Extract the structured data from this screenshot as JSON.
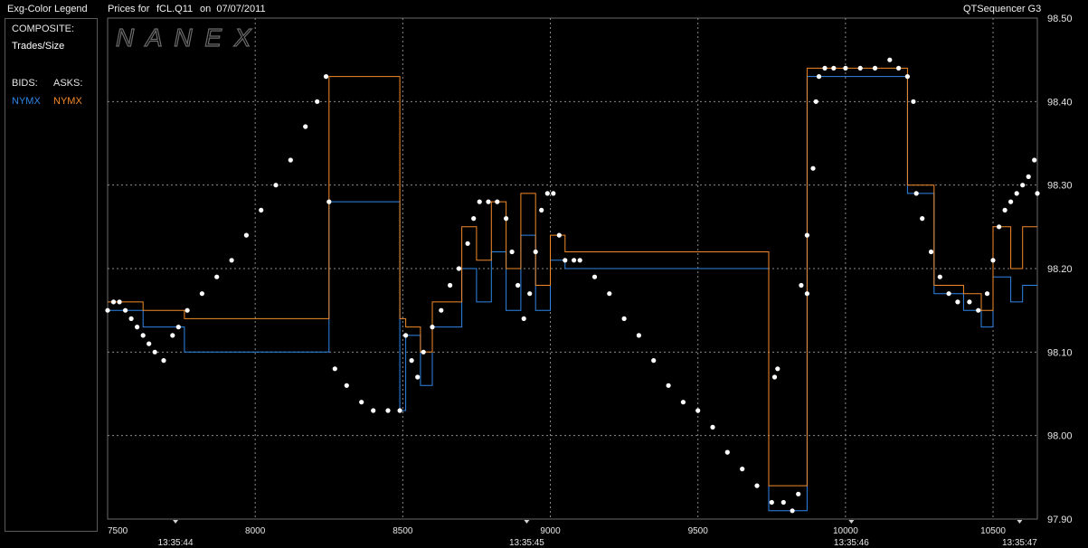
{
  "header": {
    "legend_title": "Exg-Color Legend",
    "title_label": "Prices for",
    "symbol": "fCL.Q11",
    "date_label": "on  07/07/2011",
    "app_name": "QTSequencer G3"
  },
  "legend": {
    "composite_label": "COMPOSITE:",
    "trades_label": "Trades/Size",
    "bids_label": "BIDS:",
    "asks_label": "ASKS:",
    "bid_exchange": "NYMX",
    "ask_exchange": "NYMX",
    "bid_color": "#2f86e6",
    "ask_color": "#f28a2a"
  },
  "watermark": "N A N E X",
  "colors": {
    "background": "#000000",
    "grid": "#8a8a8a",
    "trades": "#ffffff",
    "bid": "#2f86e6",
    "ask": "#f28a2a"
  },
  "chart_data": {
    "type": "scatter",
    "x_axis": {
      "range": [
        7500,
        10650
      ],
      "ticks": [
        7500,
        8000,
        8500,
        9000,
        9500,
        10000,
        10500
      ],
      "tick_labels": [
        "7500",
        "8000",
        "8500",
        "9000",
        "9500",
        "10000",
        "10500"
      ],
      "time_markers": [
        {
          "x": 7730,
          "label": "13:35:44"
        },
        {
          "x": 8920,
          "label": "13:35:45"
        },
        {
          "x": 10020,
          "label": "13:35:46"
        },
        {
          "x": 10590,
          "label": "13:35:47"
        }
      ]
    },
    "y_axis": {
      "range": [
        97.9,
        98.5
      ],
      "ticks": [
        97.9,
        98.0,
        98.1,
        98.2,
        98.3,
        98.4,
        98.5
      ],
      "tick_labels": [
        "97.90",
        "98.00",
        "98.10",
        "98.20",
        "98.30",
        "98.40",
        "98.50"
      ],
      "position": "right"
    },
    "grid": true,
    "series": [
      {
        "name": "Trades/Size",
        "style": "dots",
        "points": [
          [
            7500,
            98.15
          ],
          [
            7520,
            98.16
          ],
          [
            7540,
            98.16
          ],
          [
            7560,
            98.15
          ],
          [
            7580,
            98.14
          ],
          [
            7600,
            98.13
          ],
          [
            7620,
            98.12
          ],
          [
            7640,
            98.11
          ],
          [
            7660,
            98.1
          ],
          [
            7690,
            98.09
          ],
          [
            7720,
            98.12
          ],
          [
            7740,
            98.13
          ],
          [
            7770,
            98.15
          ],
          [
            7820,
            98.17
          ],
          [
            7870,
            98.19
          ],
          [
            7920,
            98.21
          ],
          [
            7970,
            98.24
          ],
          [
            8020,
            98.27
          ],
          [
            8070,
            98.3
          ],
          [
            8120,
            98.33
          ],
          [
            8170,
            98.37
          ],
          [
            8210,
            98.4
          ],
          [
            8240,
            98.43
          ],
          [
            8250,
            98.28
          ],
          [
            8270,
            98.08
          ],
          [
            8310,
            98.06
          ],
          [
            8360,
            98.04
          ],
          [
            8400,
            98.03
          ],
          [
            8450,
            98.03
          ],
          [
            8490,
            98.03
          ],
          [
            8510,
            98.12
          ],
          [
            8530,
            98.09
          ],
          [
            8550,
            98.07
          ],
          [
            8570,
            98.1
          ],
          [
            8600,
            98.13
          ],
          [
            8630,
            98.15
          ],
          [
            8660,
            98.18
          ],
          [
            8690,
            98.2
          ],
          [
            8720,
            98.23
          ],
          [
            8740,
            98.26
          ],
          [
            8760,
            98.28
          ],
          [
            8790,
            98.28
          ],
          [
            8820,
            98.28
          ],
          [
            8850,
            98.26
          ],
          [
            8870,
            98.22
          ],
          [
            8890,
            98.18
          ],
          [
            8910,
            98.14
          ],
          [
            8930,
            98.17
          ],
          [
            8950,
            98.22
          ],
          [
            8970,
            98.27
          ],
          [
            8990,
            98.29
          ],
          [
            9010,
            98.29
          ],
          [
            9030,
            98.24
          ],
          [
            9050,
            98.21
          ],
          [
            9080,
            98.21
          ],
          [
            9100,
            98.21
          ],
          [
            9150,
            98.19
          ],
          [
            9200,
            98.17
          ],
          [
            9250,
            98.14
          ],
          [
            9300,
            98.12
          ],
          [
            9350,
            98.09
          ],
          [
            9400,
            98.06
          ],
          [
            9450,
            98.04
          ],
          [
            9500,
            98.03
          ],
          [
            9550,
            98.01
          ],
          [
            9600,
            97.98
          ],
          [
            9650,
            97.96
          ],
          [
            9700,
            97.94
          ],
          [
            9750,
            97.92
          ],
          [
            9790,
            97.92
          ],
          [
            9820,
            97.91
          ],
          [
            9840,
            97.93
          ],
          [
            9850,
            98.18
          ],
          [
            9870,
            98.24
          ],
          [
            9890,
            98.32
          ],
          [
            9900,
            98.4
          ],
          [
            9910,
            98.43
          ],
          [
            9930,
            98.44
          ],
          [
            9960,
            98.44
          ],
          [
            10000,
            98.44
          ],
          [
            10050,
            98.44
          ],
          [
            10100,
            98.44
          ],
          [
            10150,
            98.45
          ],
          [
            10180,
            98.44
          ],
          [
            10210,
            98.43
          ],
          [
            10230,
            98.4
          ],
          [
            10240,
            98.29
          ],
          [
            10260,
            98.26
          ],
          [
            10290,
            98.22
          ],
          [
            10320,
            98.19
          ],
          [
            10350,
            98.17
          ],
          [
            10380,
            98.16
          ],
          [
            10420,
            98.16
          ],
          [
            10450,
            98.15
          ],
          [
            10480,
            98.17
          ],
          [
            10500,
            98.21
          ],
          [
            10520,
            98.25
          ],
          [
            10540,
            98.27
          ],
          [
            10560,
            98.28
          ],
          [
            10580,
            98.29
          ],
          [
            10600,
            98.3
          ],
          [
            10620,
            98.31
          ],
          [
            10640,
            98.33
          ],
          [
            10650,
            98.29
          ],
          [
            9760,
            98.07
          ],
          [
            9770,
            98.08
          ],
          [
            9870,
            98.17
          ]
        ]
      },
      {
        "name": "NYMX",
        "side": "bid",
        "style": "step",
        "points": [
          [
            7500,
            98.15
          ],
          [
            7620,
            98.15
          ],
          [
            7620,
            98.13
          ],
          [
            7760,
            98.13
          ],
          [
            7760,
            98.1
          ],
          [
            8250,
            98.1
          ],
          [
            8250,
            98.28
          ],
          [
            8490,
            98.28
          ],
          [
            8490,
            98.03
          ],
          [
            8510,
            98.03
          ],
          [
            8510,
            98.12
          ],
          [
            8560,
            98.12
          ],
          [
            8560,
            98.06
          ],
          [
            8600,
            98.06
          ],
          [
            8600,
            98.13
          ],
          [
            8700,
            98.13
          ],
          [
            8700,
            98.2
          ],
          [
            8750,
            98.2
          ],
          [
            8750,
            98.16
          ],
          [
            8800,
            98.16
          ],
          [
            8800,
            98.22
          ],
          [
            8850,
            98.22
          ],
          [
            8850,
            98.15
          ],
          [
            8900,
            98.15
          ],
          [
            8900,
            98.24
          ],
          [
            8950,
            98.24
          ],
          [
            8950,
            98.15
          ],
          [
            9000,
            98.15
          ],
          [
            9000,
            98.21
          ],
          [
            9050,
            98.21
          ],
          [
            9050,
            98.2
          ],
          [
            9740,
            98.2
          ],
          [
            9740,
            97.91
          ],
          [
            9870,
            97.91
          ],
          [
            9870,
            98.43
          ],
          [
            10210,
            98.43
          ],
          [
            10210,
            98.29
          ],
          [
            10300,
            98.29
          ],
          [
            10300,
            98.17
          ],
          [
            10400,
            98.17
          ],
          [
            10400,
            98.15
          ],
          [
            10460,
            98.15
          ],
          [
            10460,
            98.13
          ],
          [
            10500,
            98.13
          ],
          [
            10500,
            98.19
          ],
          [
            10560,
            98.19
          ],
          [
            10560,
            98.16
          ],
          [
            10600,
            98.16
          ],
          [
            10600,
            98.18
          ],
          [
            10650,
            98.18
          ]
        ]
      },
      {
        "name": "NYMX",
        "side": "ask",
        "style": "step",
        "points": [
          [
            7500,
            98.16
          ],
          [
            7620,
            98.16
          ],
          [
            7620,
            98.15
          ],
          [
            7760,
            98.15
          ],
          [
            7760,
            98.14
          ],
          [
            8250,
            98.14
          ],
          [
            8250,
            98.43
          ],
          [
            8490,
            98.43
          ],
          [
            8490,
            98.14
          ],
          [
            8510,
            98.14
          ],
          [
            8510,
            98.13
          ],
          [
            8560,
            98.13
          ],
          [
            8560,
            98.1
          ],
          [
            8600,
            98.1
          ],
          [
            8600,
            98.16
          ],
          [
            8700,
            98.16
          ],
          [
            8700,
            98.25
          ],
          [
            8750,
            98.25
          ],
          [
            8750,
            98.21
          ],
          [
            8800,
            98.21
          ],
          [
            8800,
            98.28
          ],
          [
            8850,
            98.28
          ],
          [
            8850,
            98.2
          ],
          [
            8900,
            98.2
          ],
          [
            8900,
            98.29
          ],
          [
            8950,
            98.29
          ],
          [
            8950,
            98.18
          ],
          [
            9000,
            98.18
          ],
          [
            9000,
            98.24
          ],
          [
            9050,
            98.24
          ],
          [
            9050,
            98.22
          ],
          [
            9740,
            98.22
          ],
          [
            9740,
            97.94
          ],
          [
            9870,
            97.94
          ],
          [
            9870,
            98.44
          ],
          [
            10210,
            98.44
          ],
          [
            10210,
            98.3
          ],
          [
            10300,
            98.3
          ],
          [
            10300,
            98.18
          ],
          [
            10400,
            98.18
          ],
          [
            10400,
            98.17
          ],
          [
            10460,
            98.17
          ],
          [
            10460,
            98.15
          ],
          [
            10500,
            98.15
          ],
          [
            10500,
            98.25
          ],
          [
            10560,
            98.25
          ],
          [
            10560,
            98.2
          ],
          [
            10600,
            98.2
          ],
          [
            10600,
            98.25
          ],
          [
            10650,
            98.25
          ]
        ]
      }
    ]
  }
}
